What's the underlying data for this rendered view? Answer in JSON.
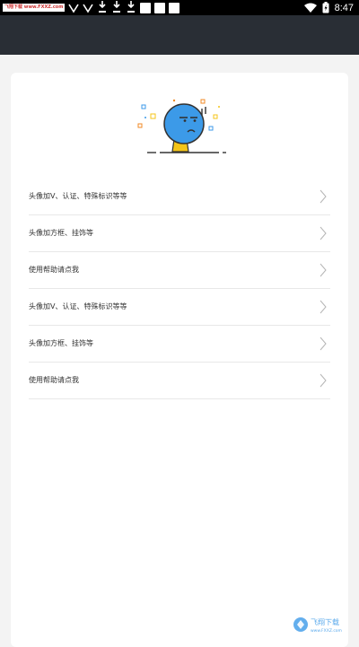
{
  "status_bar": {
    "time": "8:47",
    "watermark_text": "飞翔下载 www.FXXZ.com",
    "battery_icon": "battery-charging-icon",
    "wifi_icon": "wifi-icon"
  },
  "header": {
    "color": "#292e35"
  },
  "list": {
    "items": [
      {
        "label": "头像加V、认证、特殊标识等等"
      },
      {
        "label": "头像加方框、挂饰等"
      },
      {
        "label": "使用帮助请点我"
      },
      {
        "label": "头像加V、认证、特殊标识等等"
      },
      {
        "label": "头像加方框、挂饰等"
      },
      {
        "label": "使用帮助请点我"
      }
    ]
  },
  "watermark_logo": {
    "text": "飞翔下载",
    "sub": "www.FXXZ.com"
  },
  "colors": {
    "accent_blue": "#3c9ae8",
    "accent_yellow": "#f5c518",
    "background": "#f3f3f3",
    "card": "#ffffff",
    "divider": "#e8e8e8"
  }
}
